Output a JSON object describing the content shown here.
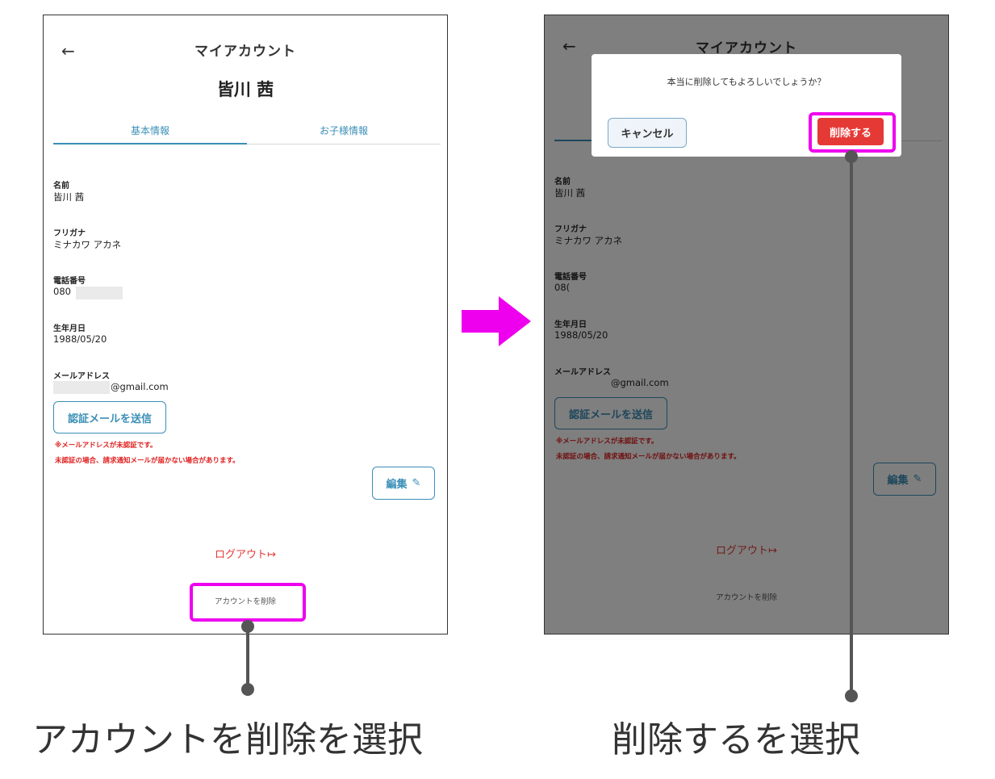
{
  "left_screen": {
    "title": "マイアカウント",
    "name": "皆川 茜",
    "tabs": [
      "基本情報",
      "お子様情報"
    ],
    "fields": {
      "name_label": "名前",
      "name_value": "皆川 茜",
      "kana_label": "フリガナ",
      "kana_value": "ミナカワ アカネ",
      "phone_label": "電話番号",
      "phone_value": "080",
      "birth_label": "生年月日",
      "birth_value": "1988/05/20",
      "email_label": "メールアドレス",
      "email_value": "@gmail.com"
    },
    "verify_button": "認証メールを送信",
    "warning_1": "※メールアドレスが未認証です。",
    "warning_2": "未認証の場合、請求通知メールが届かない場合があります。",
    "edit_button": "編集",
    "logout": "ログアウト",
    "delete_account": "アカウントを削除"
  },
  "right_screen": {
    "title": "マイアカウント",
    "dialog_message": "本当に削除してもよろしいでしょうか？",
    "cancel_button": "キャンセル",
    "confirm_button": "削除する",
    "fields": {
      "name_label": "名前",
      "name_value": "皆川 茜",
      "kana_label": "フリガナ",
      "kana_value": "ミナカワ アカネ",
      "phone_label": "電話番号",
      "phone_value": "08(",
      "birth_label": "生年月日",
      "birth_value": "1988/05/20",
      "email_label": "メールアドレス",
      "email_value": "@gmail.com"
    },
    "verify_button": "認証メールを送信",
    "warning_1": "※メールアドレスが未認証です。",
    "warning_2": "未認証の場合、請求通知メールが届かない場合があります。",
    "edit_button": "編集",
    "logout": "ログアウト",
    "delete_account": "アカウントを削除"
  },
  "captions": {
    "left": "アカウントを削除を選択",
    "right": "削除するを選択"
  },
  "icons": {
    "back": "arrow-left-icon",
    "edit": "pencil-icon",
    "logout": "logout-icon"
  },
  "colors": {
    "accent": "#3a8fb7",
    "danger": "#e53935",
    "highlight": "#ee00ee"
  }
}
